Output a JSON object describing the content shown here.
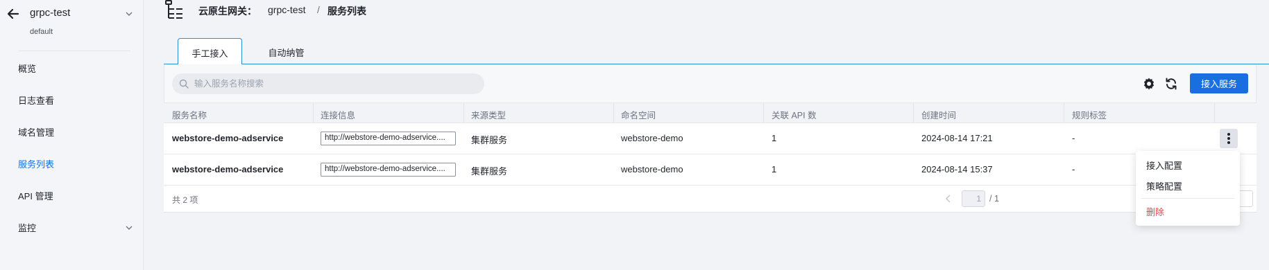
{
  "sidebar": {
    "gateway_name": "grpc-test",
    "namespace": "default",
    "items": [
      {
        "label": "概览"
      },
      {
        "label": "日志查看"
      },
      {
        "label": "域名管理"
      },
      {
        "label": "服务列表"
      },
      {
        "label": "API 管理"
      },
      {
        "label": "监控"
      }
    ],
    "active_item": "服务列表"
  },
  "header": {
    "breadcrumb_root": "云原生网关：",
    "breadcrumb_gateway": "grpc-test",
    "breadcrumb_separator": "/",
    "breadcrumb_current": "服务列表"
  },
  "tabs": [
    {
      "label": "手工接入",
      "active": true
    },
    {
      "label": "自动纳管",
      "active": false
    }
  ],
  "toolbar": {
    "search_placeholder": "输入服务名称搜索",
    "primary_button": "接入服务",
    "icons": [
      "gear-icon",
      "refresh-icon"
    ]
  },
  "table": {
    "columns": [
      "服务名称",
      "连接信息",
      "来源类型",
      "命名空间",
      "关联 API 数",
      "创建时间",
      "规则标签"
    ],
    "rows": [
      {
        "name": "webstore-demo-adservice",
        "connection": "http://webstore-demo-adservice....",
        "source": "集群服务",
        "namespace": "webstore-demo",
        "api_count": "1",
        "created": "2024-08-14 17:21",
        "tags": "-"
      },
      {
        "name": "webstore-demo-adservice",
        "connection": "http://webstore-demo-adservice....",
        "source": "集群服务",
        "namespace": "webstore-demo",
        "api_count": "1",
        "created": "2024-08-14 15:37",
        "tags": "-"
      }
    ],
    "total_text": "共 2 项"
  },
  "pagination": {
    "current_page": "1",
    "total_pages": "/ 1"
  },
  "row_menu": {
    "items": [
      "接入配置",
      "策略配置"
    ],
    "danger_item": "删除"
  },
  "colors": {
    "primary": "#1a6fe0",
    "tab_border": "#2a8bd6",
    "danger": "#e5484d",
    "sidebar_bg": "#f3f5f8"
  }
}
